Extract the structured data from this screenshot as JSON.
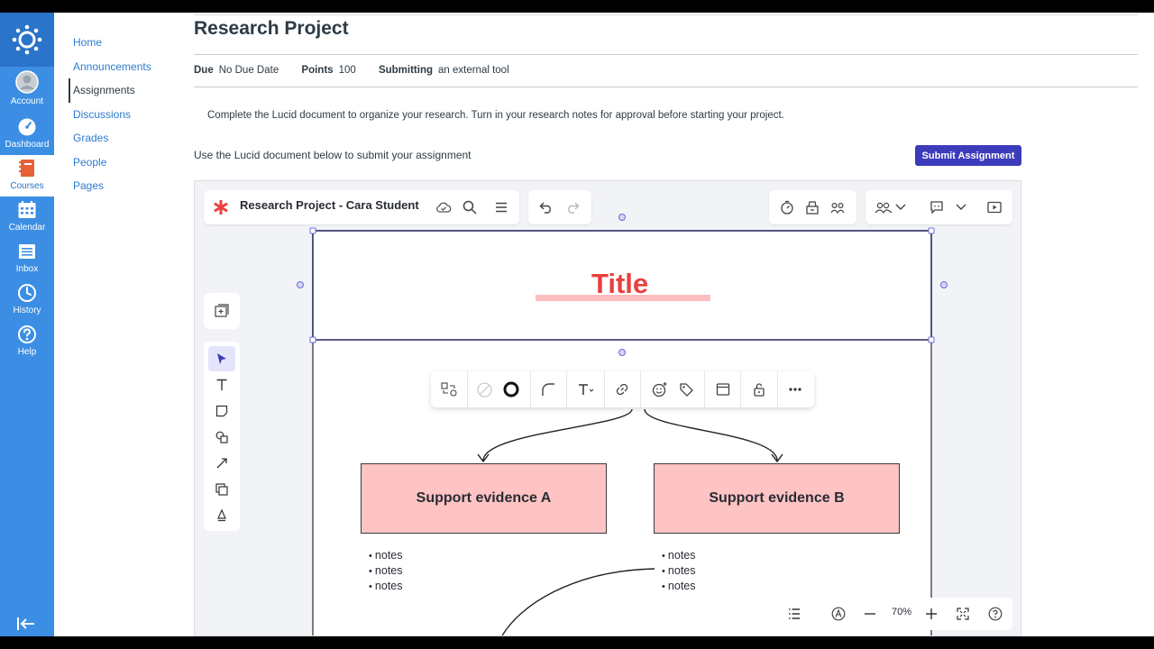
{
  "global_nav": {
    "items": [
      {
        "label": "Account",
        "icon": "account-avatar-icon"
      },
      {
        "label": "Dashboard",
        "icon": "dashboard-icon"
      },
      {
        "label": "Courses",
        "icon": "courses-icon"
      },
      {
        "label": "Calendar",
        "icon": "calendar-icon"
      },
      {
        "label": "Inbox",
        "icon": "inbox-icon"
      },
      {
        "label": "History",
        "icon": "history-icon"
      },
      {
        "label": "Help",
        "icon": "help-icon"
      }
    ]
  },
  "course_nav": {
    "items": [
      "Home",
      "Announcements",
      "Assignments",
      "Discussions",
      "Grades",
      "People",
      "Pages"
    ],
    "active": "Assignments"
  },
  "assignment": {
    "title": "Research Project",
    "due_label": "Due",
    "due_value": "No Due Date",
    "points_label": "Points",
    "points_value": "100",
    "submitting_label": "Submitting",
    "submitting_value": "an external tool",
    "description": "Complete the Lucid document to organize your research.  Turn in your research notes for approval before starting your project.",
    "use_instruction": "Use the Lucid document below to submit your assignment",
    "submit_label": "Submit Assignment"
  },
  "lucid": {
    "doc_title": "Research Project - Cara Student",
    "zoom": "70%",
    "canvas": {
      "title_text": "Title",
      "evidence_a": "Support evidence A",
      "evidence_b": "Support evidence B",
      "notes_a": [
        "notes",
        "notes",
        "notes"
      ],
      "notes_b": [
        "notes",
        "notes",
        "notes"
      ]
    }
  },
  "colors": {
    "global_nav_bg": "#3b8ee3",
    "submit_button": "#3c3bbb",
    "title_red": "#e8403f",
    "evidence_fill": "#fec3c3",
    "link_blue": "#2d7bd0"
  }
}
